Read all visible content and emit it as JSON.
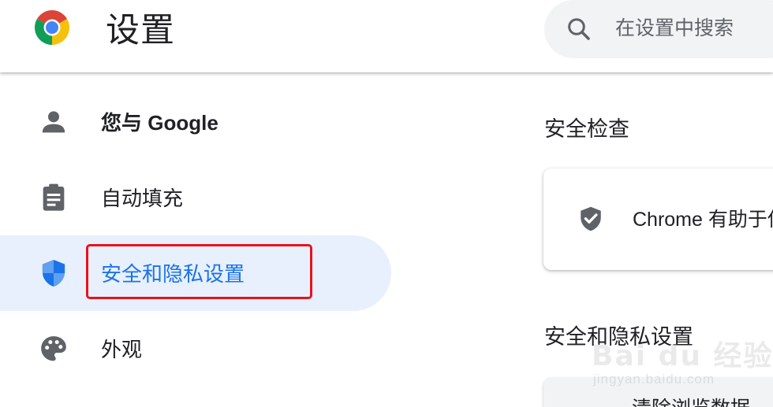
{
  "header": {
    "title": "设置",
    "search": {
      "placeholder": "在设置中搜索"
    }
  },
  "sidebar": {
    "items": [
      {
        "label": "您与 Google",
        "icon": "person-icon",
        "active": false
      },
      {
        "label": "自动填充",
        "icon": "clipboard-icon",
        "active": false
      },
      {
        "label": "安全和隐私设置",
        "icon": "shield-icon",
        "active": true
      },
      {
        "label": "外观",
        "icon": "palette-icon",
        "active": false
      }
    ]
  },
  "main": {
    "safety_check": {
      "title": "安全检查",
      "card_text": "Chrome 有助于保"
    },
    "privacy": {
      "title": "安全和隐私设置",
      "first_item": "清除浏览数据"
    }
  },
  "watermark": {
    "brand": "Bai du 经验",
    "url": "jingyan.baidu.com"
  },
  "colors": {
    "accent": "#1a73e8",
    "active_bg": "#e8f0fe",
    "highlight_box": "#e8121b",
    "icon_gray": "#5f6368"
  }
}
